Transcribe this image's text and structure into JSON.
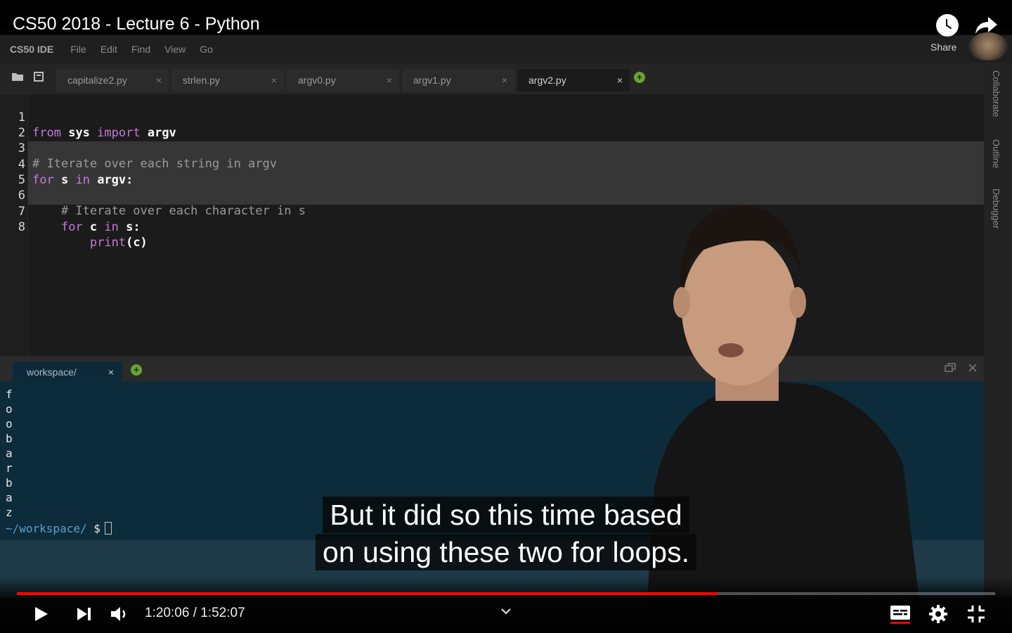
{
  "video": {
    "title": "CS50 2018 - Lecture 6 - Python",
    "share_label": "Share",
    "time_current": "1:20:06",
    "time_separator": "/",
    "time_total": "1:52:07",
    "progress": 0.7164,
    "captions": [
      "But it did so this time based",
      "on using these two for loops."
    ]
  },
  "ide": {
    "brand": "CS50 IDE",
    "menu": [
      "File",
      "Edit",
      "Find",
      "View",
      "Go"
    ],
    "tabs": [
      {
        "label": "capitalize2.py",
        "active": false
      },
      {
        "label": "strlen.py",
        "active": false
      },
      {
        "label": "argv0.py",
        "active": false
      },
      {
        "label": "argv1.py",
        "active": false
      },
      {
        "label": "argv2.py",
        "active": true
      }
    ],
    "tab_close": "×",
    "right_panel": [
      "Collaborate",
      "Outline",
      "Debugger"
    ],
    "code_lines": [
      {
        "n": "1",
        "text": "from sys import argv"
      },
      {
        "n": "2",
        "text": ""
      },
      {
        "n": "3",
        "text": "# Iterate over each string in argv"
      },
      {
        "n": "4",
        "text": "for s in argv:"
      },
      {
        "n": "5",
        "text": ""
      },
      {
        "n": "6",
        "text": "    # Iterate over each character in s"
      },
      {
        "n": "7",
        "text": "    for c in s:"
      },
      {
        "n": "8",
        "text": "        print(c)"
      }
    ],
    "terminal": {
      "tab_label": "workspace/",
      "output": [
        "f",
        "o",
        "o",
        "b",
        "a",
        "r",
        "b",
        "a",
        "z"
      ],
      "prompt": "~/workspace/",
      "prompt_symbol": "$"
    }
  },
  "colors": {
    "progress_fill": "#ff0000",
    "terminal_bg": "#0d2c3b",
    "keyword": "#c678dd",
    "plus_button": "#6aa330"
  },
  "icons": [
    "play-icon",
    "next-icon",
    "volume-icon",
    "chevron-down-icon",
    "subtitles-icon",
    "settings-icon",
    "exit-fullscreen-icon",
    "watch-later-icon",
    "share-icon"
  ]
}
